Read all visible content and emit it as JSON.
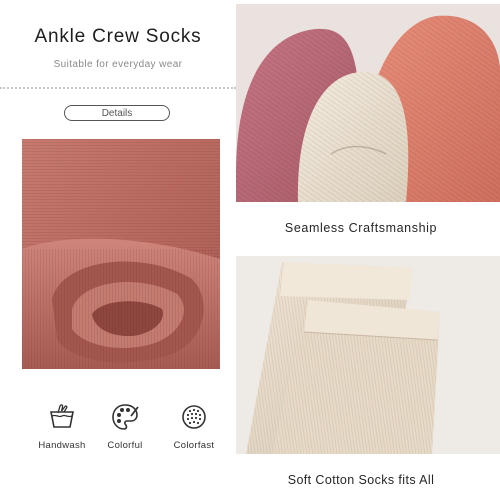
{
  "header": {
    "title": "Ankle Crew Socks",
    "subtitle": "Suitable for everyday wear",
    "details_button": "Details"
  },
  "captions": {
    "top": "Seamless Craftsmanship",
    "bottom": "Soft Cotton Socks fits All"
  },
  "features": [
    {
      "label": "Handwash",
      "icon": "handwash-icon"
    },
    {
      "label": "Colorful",
      "icon": "palette-icon"
    },
    {
      "label": "Colorfast",
      "icon": "colorfast-icon"
    }
  ],
  "colors": {
    "fabric_pink": "#c27268",
    "sock_rose": "#b86873",
    "sock_coral": "#d97d6b",
    "sock_beige": "#ece2d2",
    "sock_cream": "#e9dccb"
  }
}
